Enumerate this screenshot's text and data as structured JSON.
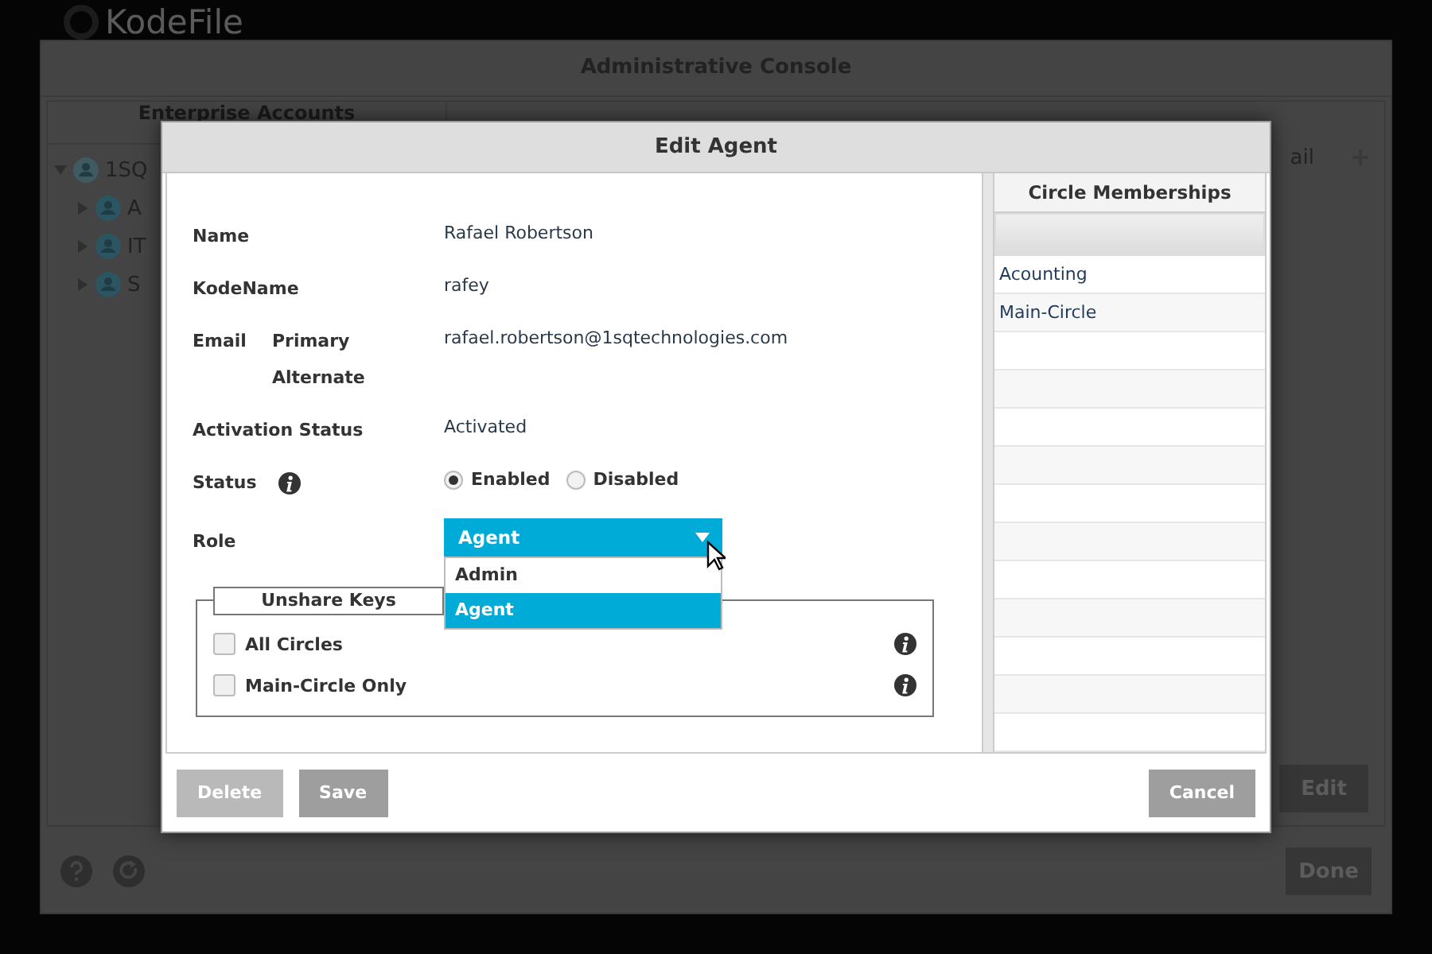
{
  "logo": {
    "text": "KodeFile"
  },
  "console": {
    "title": "Administrative Console",
    "left_header": "Enterprise Accounts",
    "right_header": "ail",
    "tree": [
      {
        "label": "1SQ",
        "expanded": true,
        "children": [
          {
            "label": "A",
            "expanded": false
          },
          {
            "label": "IT",
            "expanded": false
          },
          {
            "label": "S",
            "expanded": false
          }
        ]
      }
    ],
    "edit_button": "Edit",
    "done_button": "Done"
  },
  "dialog": {
    "title": "Edit Agent",
    "fields": [
      {
        "kind": "text",
        "label": "Name",
        "value": "Rafael Robertson"
      },
      {
        "kind": "text",
        "label": "KodeName",
        "value": "rafey"
      },
      {
        "kind": "email",
        "label": "Email",
        "sublabels": [
          "Primary",
          "Alternate"
        ],
        "value": "rafael.robertson@1sqtechnologies.com"
      },
      {
        "kind": "text",
        "label": "Activation Status",
        "value": "Activated"
      },
      {
        "kind": "radio",
        "label": "Status",
        "info": true,
        "options": [
          {
            "label": "Enabled",
            "selected": true
          },
          {
            "label": "Disabled",
            "selected": false
          }
        ]
      },
      {
        "kind": "select",
        "label": "Role",
        "value": "Agent",
        "expanded": true,
        "options": [
          {
            "label": "Admin",
            "selected": false
          },
          {
            "label": "Agent",
            "selected": true
          }
        ]
      }
    ],
    "unshare_keys": {
      "legend": "Unshare Keys",
      "items": [
        {
          "label": "All Circles",
          "checked": false
        },
        {
          "label": "Main-Circle Only",
          "checked": false
        }
      ]
    },
    "memberships": {
      "header": "Circle Memberships",
      "rows": [
        "Acounting",
        "Main-Circle"
      ]
    },
    "buttons": [
      {
        "label": "Delete",
        "disabled": true
      },
      {
        "label": "Save",
        "disabled": false
      }
    ],
    "cancel": "Cancel"
  }
}
